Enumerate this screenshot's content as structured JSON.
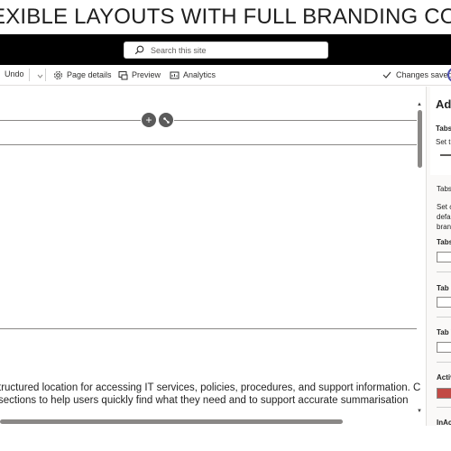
{
  "banner": {
    "title": "EXIBLE LAYOUTS WITH FULL BRANDING CONTR"
  },
  "search": {
    "placeholder": "Search this site"
  },
  "toolbar": {
    "undo_label": "Undo",
    "page_details_label": "Page details",
    "preview_label": "Preview",
    "analytics_label": "Analytics",
    "status_label": "Changes saved"
  },
  "canvas": {
    "add_section_symbol": "+",
    "line1": "tructured location for accessing IT services, policies, procedures, and support information. C",
    "line2": "sections to help users quickly find what they need and to support accurate summarisation"
  },
  "panel": {
    "title": "Adv",
    "tabs_heading": "Tabs",
    "set_text": "Set t",
    "tabs_subheading": "Tabs",
    "desc_line1": "Set c",
    "desc_line2": "defa",
    "desc_line3": "bran",
    "field1_label": "Tabs",
    "field2_label": "Tab I",
    "field3_label": "Tab T",
    "active_label": "Activ",
    "inactive_label": "InAc",
    "active_color": "#c24a45"
  }
}
